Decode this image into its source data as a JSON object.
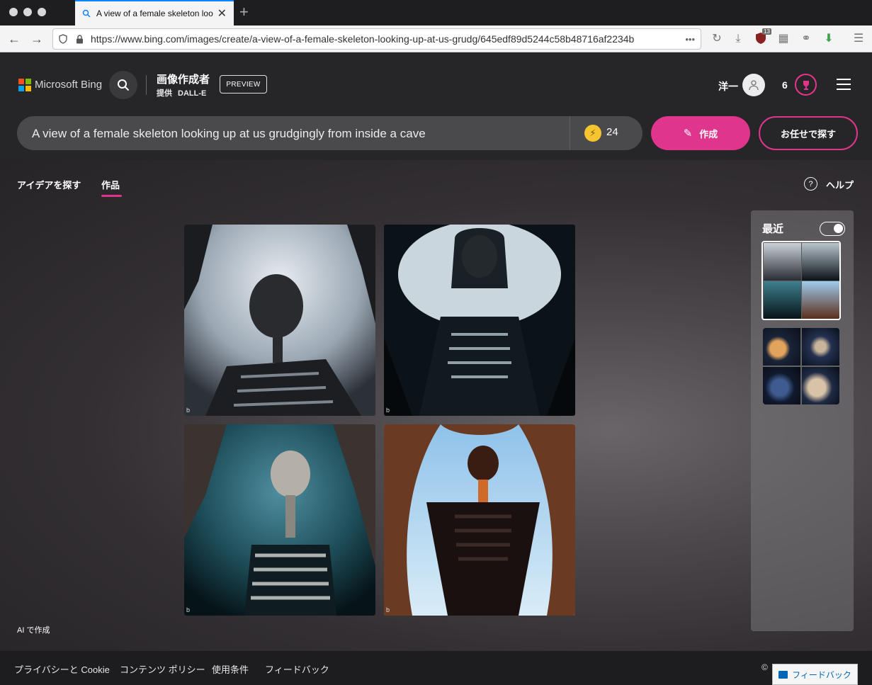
{
  "browser": {
    "tab_title": "A view of a female skeleton looking up",
    "url": "https://www.bing.com/images/create/a-view-of-a-female-skeleton-looking-up-at-us-grudg/645edf89d5244c58b48716af2234b",
    "shield_count": "13"
  },
  "header": {
    "brand": "Microsoft Bing",
    "product_title": "画像作成者",
    "provider_label": "提供",
    "provider_name": "DALL-E",
    "preview_badge": "PREVIEW",
    "user_name": "洋一",
    "rewards_count": "6"
  },
  "prompt": {
    "text": "A view of a female skeleton looking up at us grudgingly from inside a cave",
    "boosts": "24",
    "create_label": "作成",
    "surprise_label": "お任せで探す"
  },
  "nav": {
    "explore": "アイデアを探す",
    "creations": "作品",
    "help": "ヘルプ"
  },
  "results": {
    "ai_label": "AI で作成",
    "watermark": "b"
  },
  "recent": {
    "title": "最近"
  },
  "footer": {
    "privacy": "プライバシーと Cookie",
    "content_policy": "コンテンツ ポリシー",
    "terms": "使用条件",
    "feedback": "フィードバック",
    "copyright": "©",
    "feedback_button": "フィードバック"
  },
  "colors": {
    "accent": "#e0358c",
    "boost": "#f5c430"
  }
}
